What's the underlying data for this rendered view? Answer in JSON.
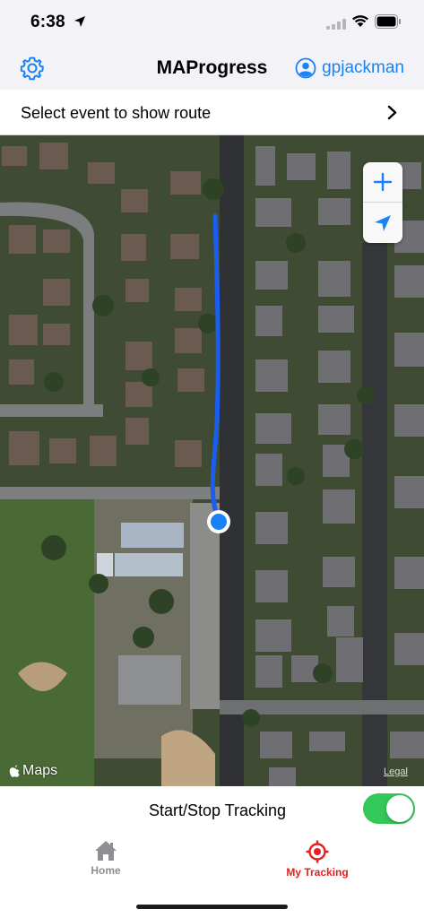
{
  "status_bar": {
    "time": "6:38",
    "icons": [
      "location-arrow-icon",
      "cellular-signal-icon",
      "wifi-icon",
      "battery-icon"
    ]
  },
  "nav": {
    "title": "MAProgress",
    "username": "gpjackman",
    "settings_icon": "gear-icon",
    "user_icon": "person-circle-icon"
  },
  "event_selector": {
    "label": "Select event to show route",
    "icon": "chevron-right-icon"
  },
  "map": {
    "attribution": "Maps",
    "legal": "Legal",
    "controls": [
      "zoom-in-icon",
      "location-arrow-icon"
    ],
    "route_color": "#1a5ef0",
    "current_location_color": "#1a82f7"
  },
  "tracking": {
    "label": "Start/Stop Tracking",
    "enabled": true,
    "toggle_color": "#34c759"
  },
  "tab_bar": {
    "tabs": [
      {
        "label": "Home",
        "icon": "house-icon",
        "selected": false
      },
      {
        "label": "My Tracking",
        "icon": "target-icon",
        "selected": true
      }
    ],
    "selected_color": "#e3211e"
  },
  "colors": {
    "accent": "#1a82f7",
    "bar_background": "#f2f2f7"
  }
}
